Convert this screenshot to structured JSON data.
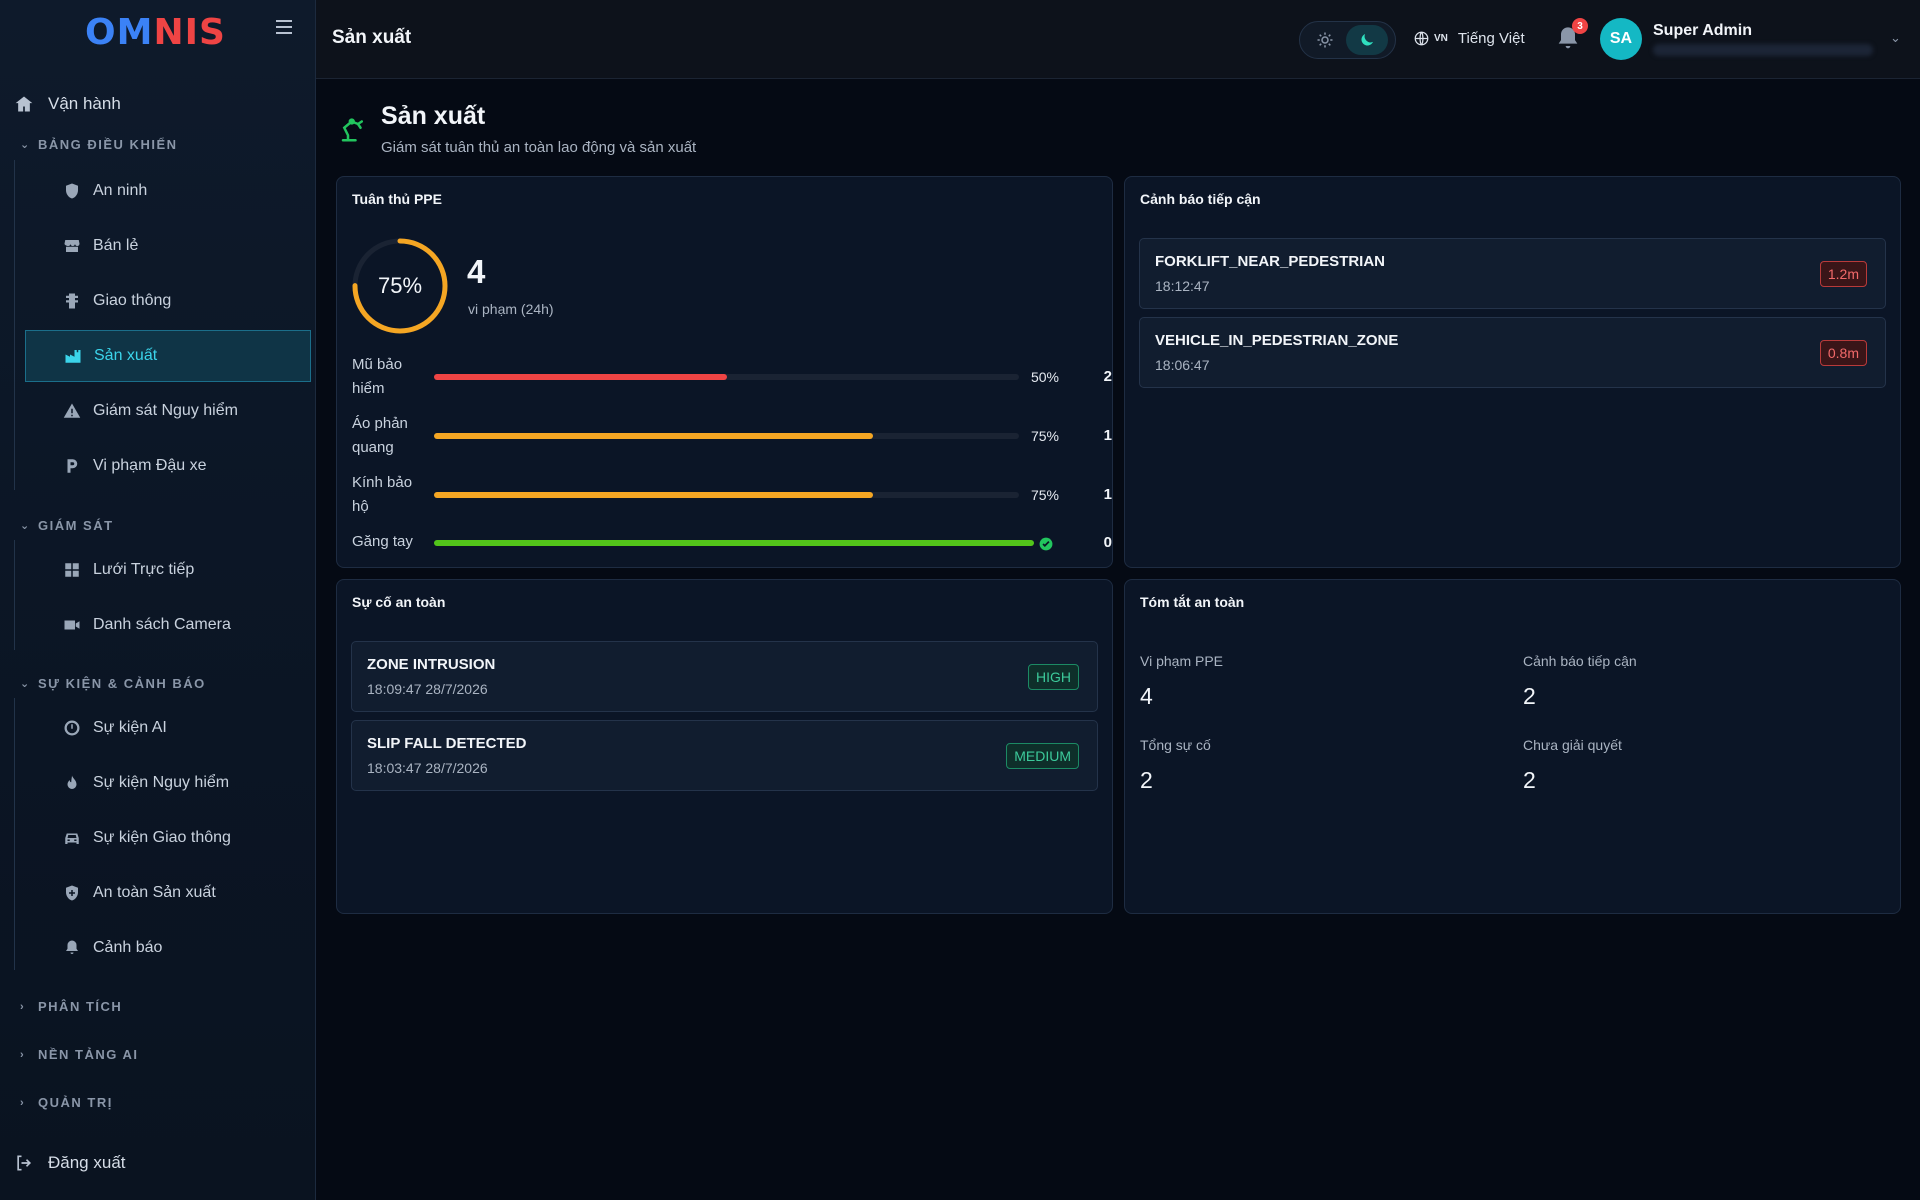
{
  "app": {
    "logo_part1": "OM",
    "logo_part2": "NIS"
  },
  "sidebar": {
    "top_item": "Vận hành",
    "sections": [
      {
        "label": "BẢNG ĐIỀU KHIỂN",
        "expanded": true
      },
      {
        "label": "GIÁM SÁT",
        "expanded": true
      },
      {
        "label": "SỰ KIỆN & CẢNH BÁO",
        "expanded": true
      },
      {
        "label": "PHÂN TÍCH",
        "expanded": false
      },
      {
        "label": "NỀN TẢNG AI",
        "expanded": false
      },
      {
        "label": "QUẢN TRỊ",
        "expanded": false
      }
    ],
    "items": [
      {
        "label": "An ninh",
        "icon": "shield-icon"
      },
      {
        "label": "Bán lẻ",
        "icon": "store-icon"
      },
      {
        "label": "Giao thông",
        "icon": "traffic-light-icon"
      },
      {
        "label": "Sản xuất",
        "icon": "factory-icon",
        "active": true
      },
      {
        "label": "Giám sát Nguy hiểm",
        "icon": "warning-icon"
      },
      {
        "label": "Vi phạm Đậu xe",
        "icon": "parking-icon"
      },
      {
        "label": "Lưới Trực tiếp",
        "icon": "grid-icon"
      },
      {
        "label": "Danh sách Camera",
        "icon": "camera-icon"
      },
      {
        "label": "Sự kiện AI",
        "icon": "ai-icon"
      },
      {
        "label": "Sự kiện Nguy hiểm",
        "icon": "fire-icon"
      },
      {
        "label": "Sự kiện Giao thông",
        "icon": "car-icon"
      },
      {
        "label": "An toàn Sản xuất",
        "icon": "shield-plus-icon"
      },
      {
        "label": "Cảnh báo",
        "icon": "bell-icon"
      }
    ],
    "logout": "Đăng xuất"
  },
  "topbar": {
    "title": "Sản xuất",
    "lang_code": "VN",
    "lang_label": "Tiếng Việt",
    "notification_count": "3",
    "avatar_initials": "SA",
    "user_name": "Super Admin",
    "theme_mode": "dark"
  },
  "page": {
    "title": "Sản xuất",
    "subtitle": "Giám sát tuân thủ an toàn lao động và sản xuất"
  },
  "ppe": {
    "title": "Tuân thủ PPE",
    "compliance_label": "75%",
    "compliance_value": 75,
    "violations": "4",
    "violations_label": "vi phạm (24h)",
    "rows": [
      {
        "name": "Mũ bảo hiểm",
        "pct_label": "50%",
        "value": 50,
        "count": "2",
        "color": "#ef4444"
      },
      {
        "name": "Áo phản quang",
        "pct_label": "75%",
        "value": 75,
        "count": "1",
        "color": "#f5a623"
      },
      {
        "name": "Kính bảo hộ",
        "pct_label": "75%",
        "value": 75,
        "count": "1",
        "color": "#f5a623"
      },
      {
        "name": "Găng tay",
        "pct_label": "",
        "value": 100,
        "count": "0",
        "color": "#52c41a"
      }
    ]
  },
  "proximity": {
    "title": "Cảnh báo tiếp cận",
    "items": [
      {
        "name": "FORKLIFT_NEAR_PEDESTRIAN",
        "time": "18:12:47",
        "distance": "1.2m"
      },
      {
        "name": "VEHICLE_IN_PEDESTRIAN_ZONE",
        "time": "18:06:47",
        "distance": "0.8m"
      }
    ]
  },
  "incidents": {
    "title": "Sự cố an toàn",
    "items": [
      {
        "name": "ZONE INTRUSION",
        "time": "18:09:47 28/7/2026",
        "severity": "HIGH"
      },
      {
        "name": "SLIP FALL DETECTED",
        "time": "18:03:47 28/7/2026",
        "severity": "MEDIUM"
      }
    ]
  },
  "summary": {
    "title": "Tóm tắt an toàn",
    "ppe_label": "Vi phạm PPE",
    "ppe_value": "4",
    "proximity_label": "Cảnh báo tiếp cận",
    "proximity_value": "2",
    "incidents_label": "Tổng sự cố",
    "incidents_value": "2",
    "unresolved_label": "Chưa giải quyết",
    "unresolved_value": "2"
  }
}
